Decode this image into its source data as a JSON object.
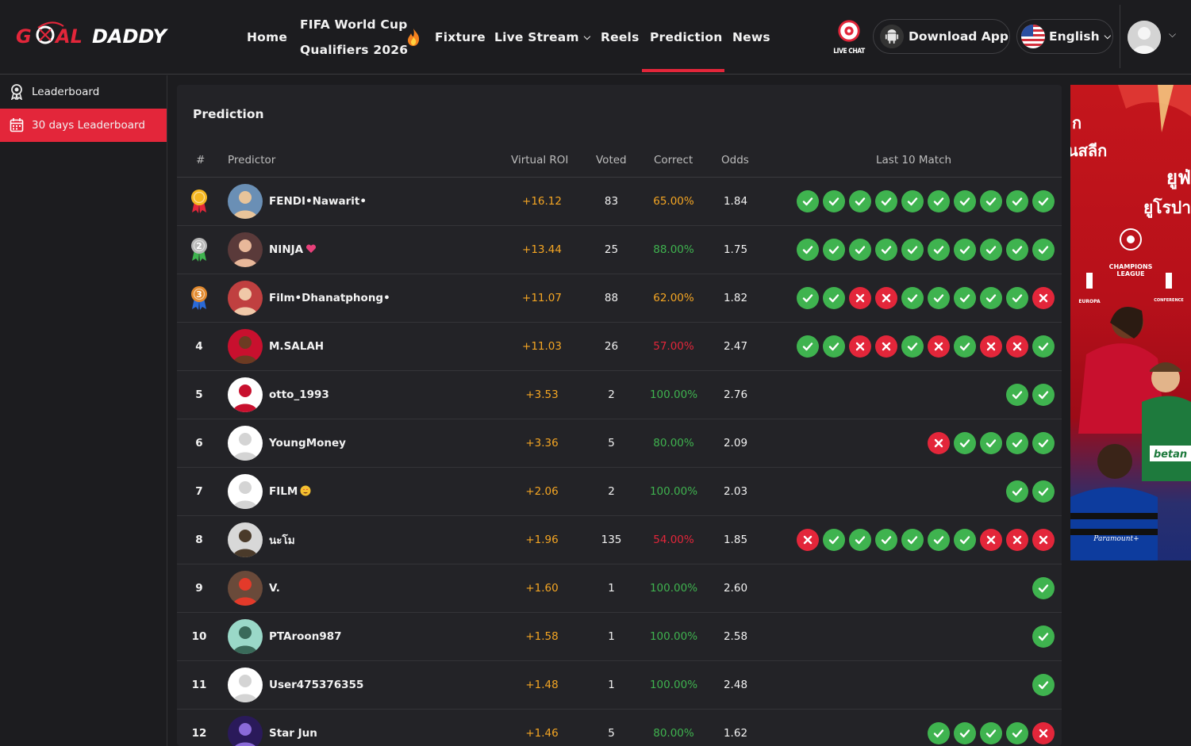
{
  "header": {
    "logo_text": "GOAL DADDY",
    "nav": {
      "home": "Home",
      "fifa_line1": "FIFA World Cup",
      "fifa_line2": "Qualifiers 2026",
      "fixture": "Fixture",
      "live_stream": "Live Stream",
      "reels": "Reels",
      "prediction": "Prediction",
      "news": "News"
    },
    "live_chat": "LIVE CHAT",
    "download_app": "Download App",
    "language": "English"
  },
  "sidebar": {
    "items": [
      {
        "label": "Leaderboard",
        "icon": "award-icon"
      },
      {
        "label": "30 days Leaderboard",
        "icon": "calendar-icon"
      }
    ]
  },
  "panel": {
    "title": "Prediction",
    "columns": {
      "rank": "#",
      "predictor": "Predictor",
      "roi": "Virtual ROI",
      "voted": "Voted",
      "correct": "Correct",
      "odds": "Odds",
      "last10": "Last 10 Match"
    }
  },
  "rows": [
    {
      "rank": "1",
      "name": "FENDI•Nawarit•",
      "roi": "+16.12",
      "voted": "83",
      "correct": "65.00%",
      "odds": "1.84",
      "results": [
        "W",
        "W",
        "W",
        "W",
        "W",
        "W",
        "W",
        "W",
        "W",
        "W"
      ]
    },
    {
      "rank": "2",
      "name": "NINJA",
      "roi": "+13.44",
      "voted": "25",
      "correct": "88.00%",
      "odds": "1.75",
      "results": [
        "W",
        "W",
        "W",
        "W",
        "W",
        "W",
        "W",
        "W",
        "W",
        "W"
      ]
    },
    {
      "rank": "3",
      "name": "Film•Dhanatphong•",
      "roi": "+11.07",
      "voted": "88",
      "correct": "62.00%",
      "odds": "1.82",
      "results": [
        "W",
        "W",
        "L",
        "L",
        "W",
        "W",
        "W",
        "W",
        "W",
        "L"
      ]
    },
    {
      "rank": "4",
      "name": "M.SALAH",
      "roi": "+11.03",
      "voted": "26",
      "correct": "57.00%",
      "odds": "2.47",
      "results": [
        "W",
        "W",
        "L",
        "L",
        "W",
        "L",
        "W",
        "L",
        "L",
        "W"
      ]
    },
    {
      "rank": "5",
      "name": "otto_1993",
      "roi": "+3.53",
      "voted": "2",
      "correct": "100.00%",
      "odds": "2.76",
      "results": [
        "W",
        "W"
      ]
    },
    {
      "rank": "6",
      "name": "YoungMoney",
      "roi": "+3.36",
      "voted": "5",
      "correct": "80.00%",
      "odds": "2.09",
      "results": [
        "L",
        "W",
        "W",
        "W",
        "W"
      ]
    },
    {
      "rank": "7",
      "name": "FILM",
      "roi": "+2.06",
      "voted": "2",
      "correct": "100.00%",
      "odds": "2.03",
      "results": [
        "W",
        "W"
      ]
    },
    {
      "rank": "8",
      "name": "นะโม",
      "roi": "+1.96",
      "voted": "135",
      "correct": "54.00%",
      "odds": "1.85",
      "results": [
        "L",
        "W",
        "W",
        "W",
        "W",
        "W",
        "W",
        "L",
        "L",
        "L"
      ]
    },
    {
      "rank": "9",
      "name": "V.",
      "roi": "+1.60",
      "voted": "1",
      "correct": "100.00%",
      "odds": "2.60",
      "results": [
        "W"
      ]
    },
    {
      "rank": "10",
      "name": "PTAroon987",
      "roi": "+1.58",
      "voted": "1",
      "correct": "100.00%",
      "odds": "2.58",
      "results": [
        "W"
      ]
    },
    {
      "rank": "11",
      "name": "User475376355",
      "roi": "+1.48",
      "voted": "1",
      "correct": "100.00%",
      "odds": "2.48",
      "results": [
        "W"
      ]
    },
    {
      "rank": "12",
      "name": "Star Jun",
      "roi": "+1.46",
      "voted": "5",
      "correct": "80.00%",
      "odds": "1.62",
      "results": [
        "W",
        "W",
        "W",
        "W",
        "L"
      ]
    }
  ],
  "banner": {
    "text_1": "ยูฟ่",
    "text_2": "ยูโรปา",
    "text_3": "นสลีก",
    "logo_main": "CHAMPIONS LEAGUE",
    "logo_left": "EUROPA LEAGUE",
    "logo_right": "CONFERENCE LEAGUE",
    "sponsor": "Paramount+",
    "shirt": "betan"
  },
  "colors": {
    "accent": "#e3263a",
    "win": "#3fb34f",
    "loss": "#e3263a",
    "roi": "#f5a623"
  }
}
